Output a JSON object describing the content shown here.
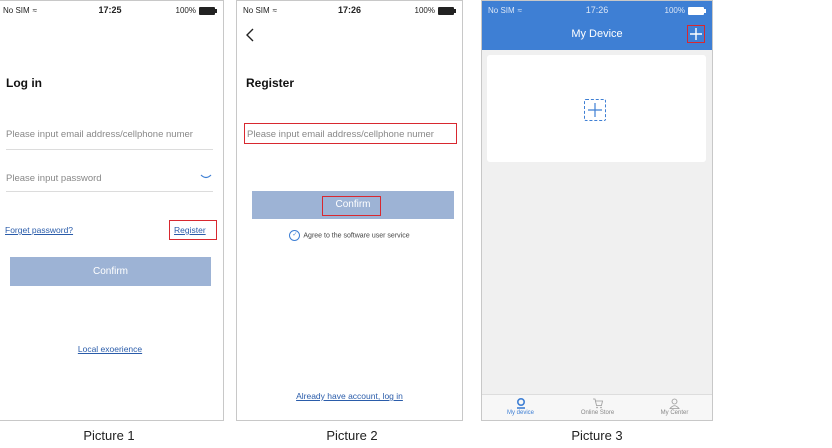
{
  "status_bar": {
    "carrier": "No SIM",
    "battery": "100%"
  },
  "picture1": {
    "time": "17:25",
    "title": "Log in",
    "email_placeholder": "Please input email address/cellphone numer",
    "password_placeholder": "Please input password",
    "forget_link": "Forget password?",
    "register_link": "Register",
    "confirm_label": "Confirm",
    "local_link": "Local exoerience",
    "caption": "Picture 1"
  },
  "picture2": {
    "time": "17:26",
    "title": "Register",
    "email_placeholder": "Please input email address/cellphone numer",
    "confirm_label": "Confirm",
    "agree_text": "Agree to the software user service",
    "login_link": "Already have account, log in",
    "caption": "Picture 2"
  },
  "picture3": {
    "time": "17:26",
    "header_title": "My Device",
    "tabs": [
      {
        "label": "My device",
        "icon": "device-icon",
        "active": true
      },
      {
        "label": "Online Store",
        "icon": "cart-icon",
        "active": false
      },
      {
        "label": "My Center",
        "icon": "person-icon",
        "active": false
      }
    ],
    "caption": "Picture 3"
  },
  "colors": {
    "accent": "#3e7fd4",
    "button": "#9db3d5",
    "highlight": "#d8282f",
    "link": "#2a5caa"
  }
}
